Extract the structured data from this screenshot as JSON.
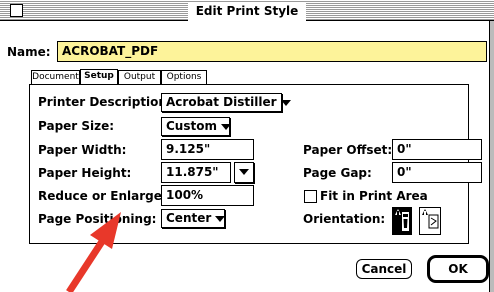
{
  "window": {
    "title": "Edit Print Style"
  },
  "name": {
    "label": "Name:",
    "value": "ACROBAT_PDF"
  },
  "tabs": [
    {
      "label": "Document",
      "active": false
    },
    {
      "label": "Setup",
      "active": true
    },
    {
      "label": "Output",
      "active": false
    },
    {
      "label": "Options",
      "active": false
    }
  ],
  "setup": {
    "printer_description": {
      "label": "Printer Description:",
      "value": "Acrobat Distiller"
    },
    "paper_size": {
      "label": "Paper Size:",
      "value": "Custom"
    },
    "paper_width": {
      "label": "Paper Width:",
      "value": "9.125\""
    },
    "paper_height": {
      "label": "Paper Height:",
      "value": "11.875\""
    },
    "reduce_enlarge": {
      "label": "Reduce or Enlarge:",
      "value": "100%"
    },
    "page_positioning": {
      "label": "Page Positioning:",
      "value": "Center"
    },
    "paper_offset": {
      "label": "Paper Offset:",
      "value": "0\""
    },
    "page_gap": {
      "label": "Page Gap:",
      "value": "0\""
    },
    "fit_in_print_area": {
      "label": "Fit in Print Area",
      "checked": false
    },
    "orientation": {
      "label": "Orientation:",
      "selected": "portrait"
    }
  },
  "buttons": {
    "cancel": "Cancel",
    "ok": "OK"
  },
  "annotation": {
    "arrow_color": "#e8382a"
  }
}
